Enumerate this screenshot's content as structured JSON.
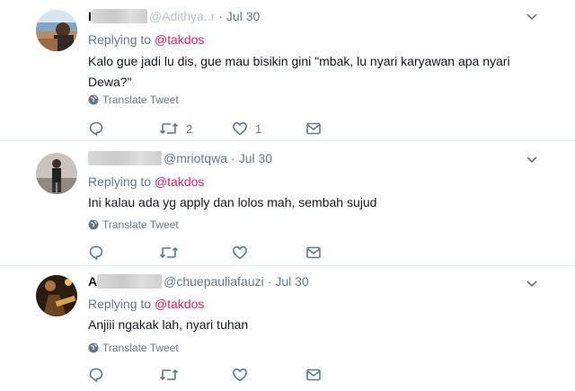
{
  "tweets": [
    {
      "name_fragment_1": "I",
      "handle": "@Adithya..r",
      "date": "Jul 30",
      "replying_prefix": "Replying to",
      "replying_to": "@takdos",
      "text": "Kalo gue jadi lu dis, gue mau bisikin gini \"mbak, lu nyari karyawan apa nyari Dewa?\"",
      "translate": "Translate Tweet",
      "retweets": "2",
      "likes": "1"
    },
    {
      "handle": "@mriotqwa",
      "date": "Jul 30",
      "replying_prefix": "Replying to",
      "replying_to": "@takdos",
      "text": "Ini kalau ada yg apply dan lolos mah, sembah sujud",
      "translate": "Translate Tweet",
      "retweets": "",
      "likes": ""
    },
    {
      "name_fragment_1": "A",
      "handle": "@chuepauliafauzi",
      "date": "Jul 30",
      "replying_prefix": "Replying to",
      "replying_to": "@takdos",
      "text": "Anjiii ngakak lah, nyari tuhan",
      "translate": "Translate Tweet",
      "retweets": "",
      "likes": ""
    }
  ],
  "colors": {
    "mention": "#e0245e",
    "muted": "#657786",
    "divider": "#e6ecf0",
    "text": "#14171a"
  },
  "icons": [
    "reply-icon",
    "retweet-icon",
    "like-icon",
    "direct-message-icon",
    "globe-icon",
    "chevron-down-icon"
  ]
}
